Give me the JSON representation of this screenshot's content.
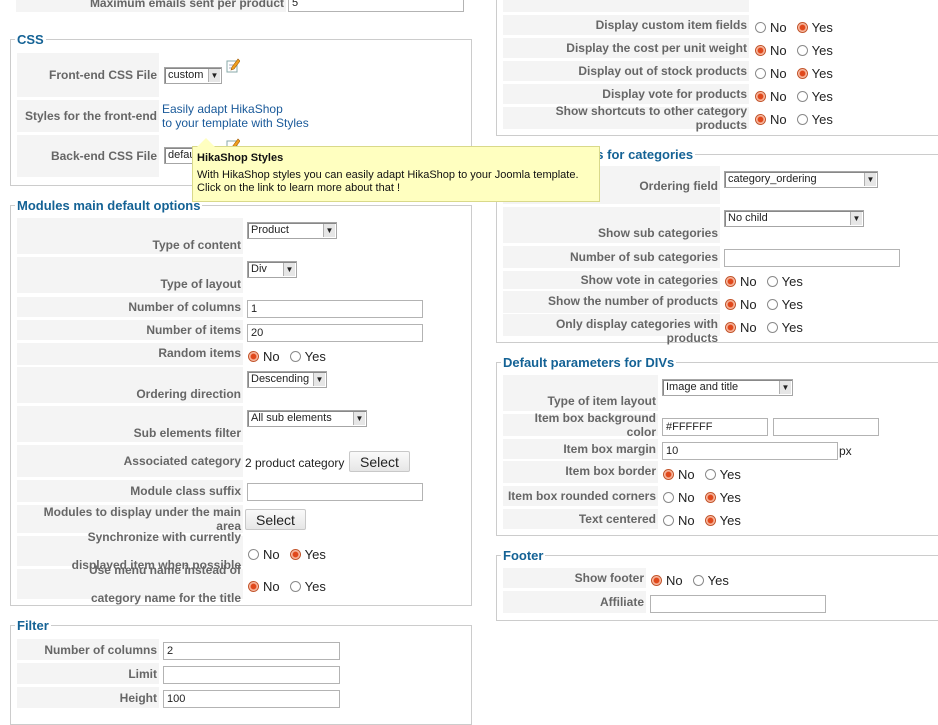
{
  "top_left": {
    "max_emails_label": "Maximum emails sent per product",
    "max_emails_value": "5"
  },
  "yes": "Yes",
  "no": "No",
  "css": {
    "legend": "CSS",
    "frontend_label": "Front-end CSS File",
    "frontend_value": "custom",
    "styles_label": "Styles for the front-end",
    "styles_link": "Easily adapt HikaShop to your template with Styles",
    "styles_link_line1": "Easily adapt HikaShop",
    "styles_link_line2": "to your template with Styles",
    "backend_label": "Back-end CSS File",
    "backend_value": "default"
  },
  "tooltip": {
    "title": "HikaShop Styles",
    "body": "With HikaShop styles you can easily adapt HikaShop to your Joomla template. Click on the link to learn more about that !"
  },
  "modules": {
    "legend": "Modules main default options",
    "type_content_label": "Type of content",
    "type_content_value": "Product",
    "type_layout_label": "Type of layout",
    "type_layout_value": "Div",
    "columns_label": "Number of columns",
    "columns_value": "1",
    "items_label": "Number of items",
    "items_value": "20",
    "random_label": "Random items",
    "random_selected": "No",
    "ordering_label": "Ordering direction",
    "ordering_value": "Descending",
    "sub_filter_label": "Sub elements filter",
    "sub_filter_value": "All sub elements",
    "assoc_label": "Associated category",
    "assoc_value": "2 product category",
    "assoc_button": "Select",
    "class_suffix_label": "Module class suffix",
    "class_suffix_value": "",
    "display_under_label": "Modules to display under the main area",
    "display_under_button": "Select",
    "sync_label_1": "Synchronize with currently",
    "sync_label_2": "displayed item when possible",
    "sync_selected": "Yes",
    "menu_name_label_1": "Use menu name instead of",
    "menu_name_label_2": "category name for the title",
    "menu_name_selected": "No"
  },
  "filter": {
    "legend": "Filter",
    "columns_label": "Number of columns",
    "columns_value": "2",
    "limit_label": "Limit",
    "limit_value": "",
    "height_label": "Height",
    "height_value": "100"
  },
  "products_right": {
    "custom_fields_label": "Display custom item fields",
    "custom_fields_selected": "Yes",
    "cost_unit_label": "Display the cost per unit weight",
    "cost_unit_selected": "No",
    "out_of_stock_label": "Display out of stock products",
    "out_of_stock_selected": "Yes",
    "vote_label": "Display vote for products",
    "vote_selected": "No",
    "shortcuts_label": "Show shortcuts to other category products",
    "shortcuts_selected": "No"
  },
  "categories": {
    "legend": "ers for categories",
    "ordering_label": "Ordering field",
    "ordering_value": "category_ordering",
    "sub_cat_label": "Show sub categories",
    "sub_cat_value": "No child",
    "num_sub_label": "Number of sub categories",
    "num_sub_value": "",
    "vote_label": "Show vote in categories",
    "vote_selected": "No",
    "num_products_label": "Show the number of products",
    "num_products_selected": "No",
    "only_with_label": "Only display categories with products",
    "only_with_selected": "No"
  },
  "divs": {
    "legend": "Default parameters for DIVs",
    "layout_label": "Type of item layout",
    "layout_value": "Image and title",
    "bg_label": "Item box background color",
    "bg_value": "#FFFFFF",
    "margin_label": "Item box margin",
    "margin_value": "10",
    "margin_unit": "px",
    "border_label": "Item box border",
    "border_selected": "No",
    "rounded_label": "Item box rounded corners",
    "rounded_selected": "Yes",
    "centered_label": "Text centered",
    "centered_selected": "Yes"
  },
  "footer": {
    "legend": "Footer",
    "show_label": "Show footer",
    "show_selected": "No",
    "affiliate_label": "Affiliate",
    "affiliate_value": ""
  },
  "colors": {
    "legend": "#146295",
    "label_bg": "#f4f4f4",
    "link": "#1a5a9a",
    "tooltip_bg": "#ffffc0",
    "radio_on": "#e0481b"
  },
  "icons": [
    "edit-css-icon",
    "chevron-down-icon",
    "radio-icon"
  ]
}
